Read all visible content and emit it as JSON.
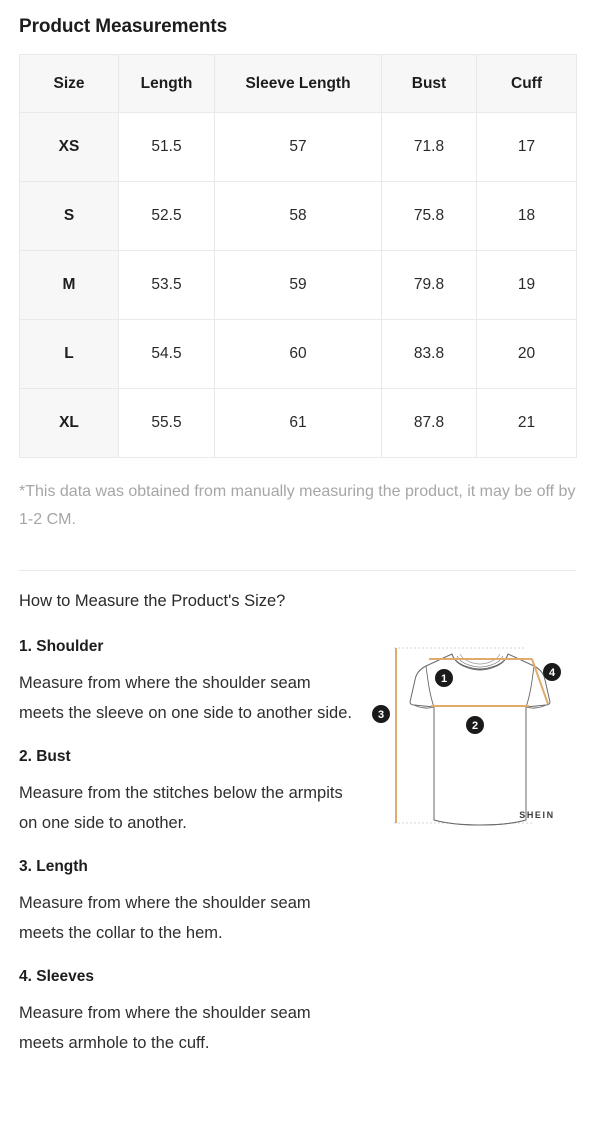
{
  "page": {
    "title": "Product Measurements"
  },
  "table": {
    "columns": [
      "Size",
      "Length",
      "Sleeve Length",
      "Bust",
      "Cuff"
    ],
    "rows": [
      {
        "size": "XS",
        "length": "51.5",
        "sleeve_length": "57",
        "bust": "71.8",
        "cuff": "17"
      },
      {
        "size": "S",
        "length": "52.5",
        "sleeve_length": "58",
        "bust": "75.8",
        "cuff": "18"
      },
      {
        "size": "M",
        "length": "53.5",
        "sleeve_length": "59",
        "bust": "79.8",
        "cuff": "19"
      },
      {
        "size": "L",
        "length": "54.5",
        "sleeve_length": "60",
        "bust": "83.8",
        "cuff": "20"
      },
      {
        "size": "XL",
        "length": "55.5",
        "sleeve_length": "61",
        "bust": "87.8",
        "cuff": "21"
      }
    ]
  },
  "disclaimer": "*This data was obtained from manually measuring the product, it may be off by 1-2 CM.",
  "howto": {
    "title": "How to Measure the Product's Size?",
    "steps": [
      {
        "title": "1. Shoulder",
        "body": "Measure from where the shoulder seam meets the sleeve on one side to another side."
      },
      {
        "title": "2. Bust",
        "body": "Measure from the stitches below the armpits on one side to another."
      },
      {
        "title": "3. Length",
        "body": "Measure from where the shoulder seam meets the collar to the hem."
      },
      {
        "title": "4. Sleeves",
        "body": "Measure from where the shoulder seam meets armhole to the cuff."
      }
    ]
  },
  "diagram": {
    "markers": [
      "1",
      "2",
      "3",
      "4"
    ],
    "brand": "SHEIN",
    "colors": {
      "measure_line": "#e0ab6e",
      "guide_line": "#d9d9d9",
      "garment_outline": "#5a5a5a",
      "marker_fill": "#1a1a1a"
    }
  },
  "colors": {
    "header_bg": "#f7f7f7",
    "border": "#e9e9e9",
    "text": "#2a2a2a",
    "muted_text": "#a6a6a6"
  }
}
